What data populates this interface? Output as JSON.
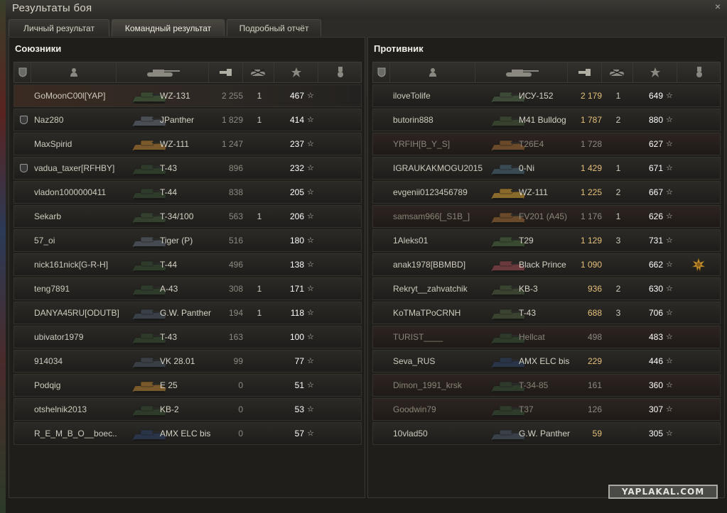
{
  "window": {
    "title": "Результаты боя",
    "close_icon": "×"
  },
  "tabs": [
    {
      "label": "Личный результат",
      "active": false
    },
    {
      "label": "Командный результат",
      "active": true
    },
    {
      "label": "Подробный отчёт",
      "active": false
    }
  ],
  "columns": [
    "clan-icon",
    "player-icon",
    "tank-icon",
    "damage-icon",
    "kills-icon",
    "xp-star-icon",
    "medal-icon"
  ],
  "allies": {
    "title": "Союзники",
    "rows": [
      {
        "name": "GoMoonC00l[YAP]",
        "tank": "WZ-131",
        "damage": "2 255",
        "kills": "1",
        "xp": "467",
        "tank_color": "#3a4a32",
        "me": true
      },
      {
        "name": "Naz280",
        "tank": "JPanther",
        "damage": "1 829",
        "kills": "1",
        "xp": "414",
        "badge": true,
        "tank_color": "#4a4e55"
      },
      {
        "name": "MaxSpirid",
        "tank": "WZ-111",
        "damage": "1 247",
        "kills": "",
        "xp": "237",
        "tank_color": "#7a5a2a"
      },
      {
        "name": "vadua_taxer[RFHBY]",
        "tank": "T-43",
        "damage": "896",
        "kills": "",
        "xp": "232",
        "badge": true,
        "tank_color": "#2e3a2a"
      },
      {
        "name": "vladon1000000411",
        "tank": "T-44",
        "damage": "838",
        "kills": "",
        "xp": "205",
        "tank_color": "#2e3a2a"
      },
      {
        "name": "Sekarb",
        "tank": "T-34/100",
        "damage": "563",
        "kills": "1",
        "xp": "206",
        "tank_color": "#33402e"
      },
      {
        "name": "57_oi",
        "tank": "Tiger (P)",
        "damage": "516",
        "kills": "",
        "xp": "180",
        "tank_color": "#454a50"
      },
      {
        "name": "nick161nick[G-R-H]",
        "tank": "T-44",
        "damage": "496",
        "kills": "",
        "xp": "138",
        "tank_color": "#2e3a2a"
      },
      {
        "name": "teng7891",
        "tank": "A-43",
        "damage": "308",
        "kills": "1",
        "xp": "171",
        "tank_color": "#2e3a2a"
      },
      {
        "name": "DANYA45RU[ODUTB]",
        "tank": "G.W. Panther",
        "damage": "194",
        "kills": "1",
        "xp": "118",
        "tank_color": "#3a4048"
      },
      {
        "name": "ubivator1979",
        "tank": "T-43",
        "damage": "163",
        "kills": "",
        "xp": "100",
        "tank_color": "#2e3a2a"
      },
      {
        "name": "914034",
        "tank": "VK 28.01",
        "damage": "99",
        "kills": "",
        "xp": "77",
        "tank_color": "#3a3f45"
      },
      {
        "name": "Podqig",
        "tank": "E 25",
        "damage": "0",
        "kills": "",
        "xp": "51",
        "tank_color": "#7a5a2a"
      },
      {
        "name": "otshelnik2013",
        "tank": "KB-2",
        "damage": "0",
        "kills": "",
        "xp": "53",
        "tank_color": "#2e3a2a"
      },
      {
        "name": "R_E_M_B_O__boec..",
        "tank": "AMX ELC bis",
        "damage": "0",
        "kills": "",
        "xp": "57",
        "tank_color": "#2a3448"
      }
    ]
  },
  "enemies": {
    "title": "Противник",
    "rows": [
      {
        "name": "iloveTolife",
        "tank": "ИСУ-152",
        "damage": "2 179",
        "kills": "1",
        "xp": "649",
        "tank_color": "#3e4a38",
        "hi": true
      },
      {
        "name": "butorin888",
        "tank": "M41 Bulldog",
        "damage": "1 787",
        "kills": "2",
        "xp": "880",
        "tank_color": "#36422e",
        "hi": true
      },
      {
        "name": "YRFIH[B_Y_S]",
        "tank": "T26E4",
        "damage": "1 728",
        "kills": "",
        "xp": "627",
        "dead": true,
        "tank_color": "#6a4a2a"
      },
      {
        "name": "IGRAUKAKMOGU2015",
        "tank": "0-Ni",
        "damage": "1 429",
        "kills": "1",
        "xp": "671",
        "tank_color": "#3a4a52",
        "hi": true
      },
      {
        "name": "evgenii0123456789",
        "tank": "WZ-111",
        "damage": "1 225",
        "kills": "2",
        "xp": "667",
        "tank_color": "#8a6a2a",
        "hi": true
      },
      {
        "name": "samsam966[_S1B_]",
        "tank": "FV201 (A45)",
        "damage": "1 176",
        "kills": "1",
        "xp": "626",
        "dead": true,
        "tank_color": "#6a4a2a"
      },
      {
        "name": "1Aleks01",
        "tank": "T29",
        "damage": "1 129",
        "kills": "3",
        "xp": "731",
        "tank_color": "#3a4a30",
        "hi": true
      },
      {
        "name": "anak1978[BBMBD]",
        "tank": "Black Prince",
        "damage": "1 090",
        "kills": "",
        "xp": "662",
        "tank_color": "#6a3a3e",
        "hi": true,
        "medal": true
      },
      {
        "name": "Rekryt__zahvatchik",
        "tank": "KB-3",
        "damage": "936",
        "kills": "2",
        "xp": "630",
        "tank_color": "#3a4230",
        "hi": true
      },
      {
        "name": "KoTMaTPoCRNH",
        "tank": "T-43",
        "damage": "688",
        "kills": "3",
        "xp": "706",
        "tank_color": "#3a4230",
        "hi": true
      },
      {
        "name": "TURIST____",
        "tank": "Hellcat",
        "damage": "498",
        "kills": "",
        "xp": "483",
        "dead": true,
        "tank_color": "#2e3a2a"
      },
      {
        "name": "Seva_RUS",
        "tank": "AMX ELC bis",
        "damage": "229",
        "kills": "",
        "xp": "446",
        "tank_color": "#2a3448",
        "hi": true
      },
      {
        "name": "Dimon_1991_krsk",
        "tank": "T-34-85",
        "damage": "161",
        "kills": "",
        "xp": "360",
        "dead": true,
        "tank_color": "#2e3a2a"
      },
      {
        "name": "Goodwin79",
        "tank": "T37",
        "damage": "126",
        "kills": "",
        "xp": "307",
        "dead": true,
        "tank_color": "#2e3a2a"
      },
      {
        "name": "10vlad50",
        "tank": "G.W. Panther",
        "damage": "59",
        "kills": "",
        "xp": "305",
        "tank_color": "#3a4048",
        "hi": true
      }
    ]
  },
  "watermark": {
    "text": "YAPLAKAL.COM"
  }
}
